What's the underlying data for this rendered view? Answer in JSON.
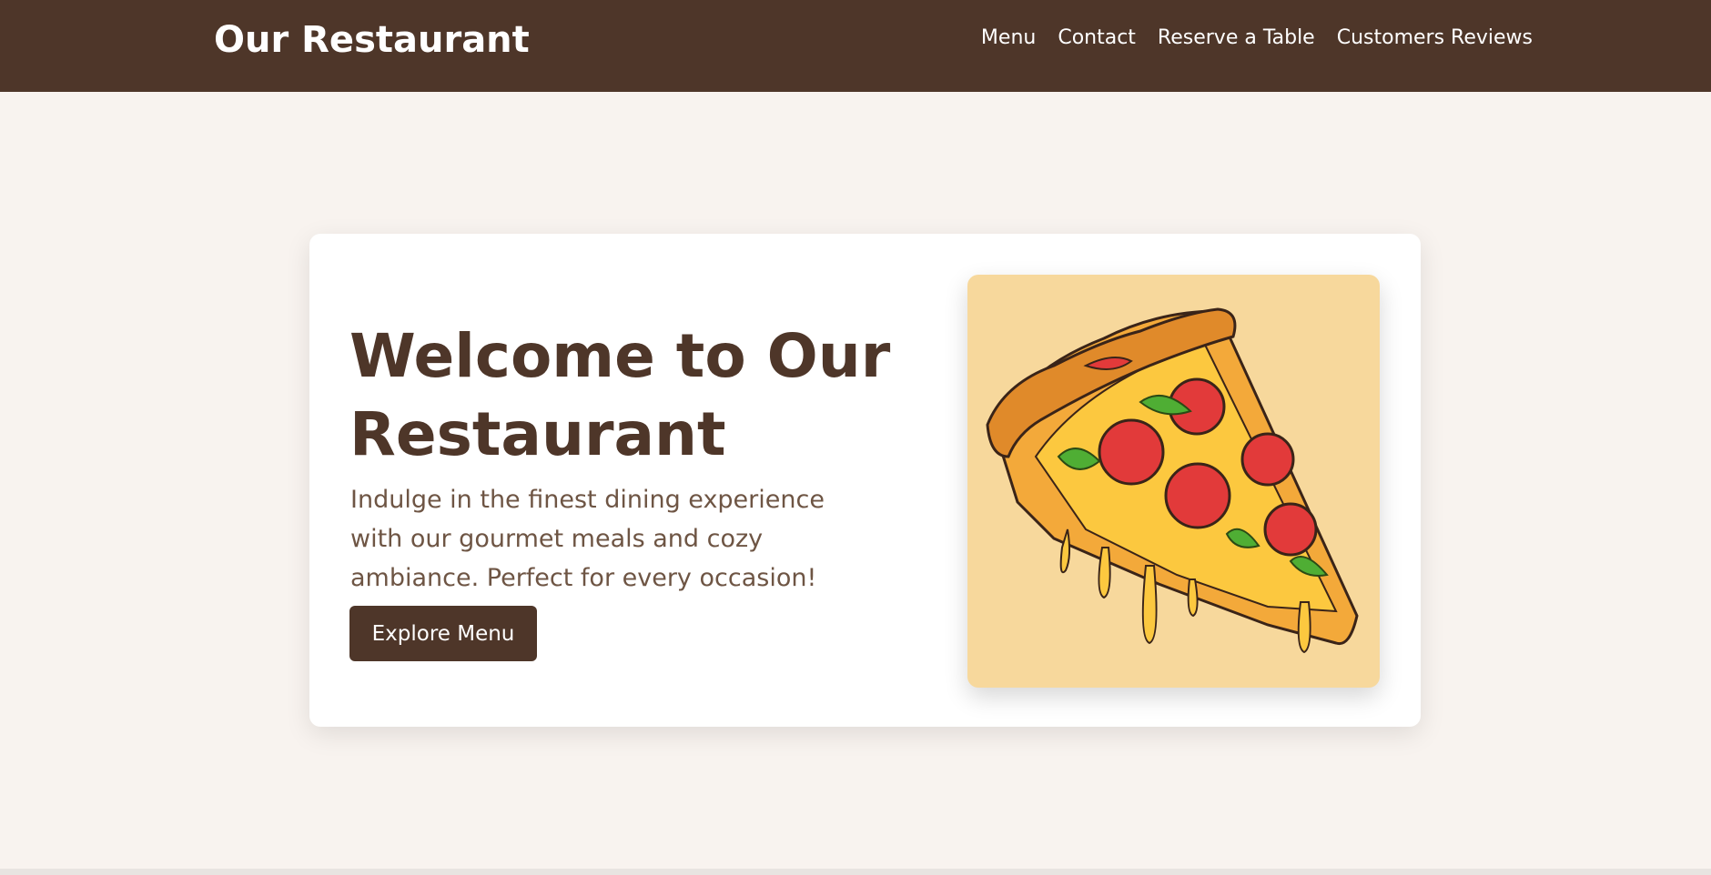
{
  "header": {
    "brand": "Our Restaurant",
    "nav": [
      {
        "label": "Menu"
      },
      {
        "label": "Contact"
      },
      {
        "label": "Reserve a Table"
      },
      {
        "label": "Customers Reviews"
      }
    ]
  },
  "hero": {
    "title": "Welcome to Our Restaurant",
    "description": "Indulge in the finest dining experience with our gourmet meals and cozy ambiance. Perfect for every occasion!",
    "cta_label": "Explore Menu",
    "image": "pizza-slice-illustration"
  },
  "colors": {
    "brand_brown": "#4e3629",
    "page_background": "#f8f3ef",
    "text_muted": "#6e5544",
    "image_background": "#f7d89c"
  }
}
